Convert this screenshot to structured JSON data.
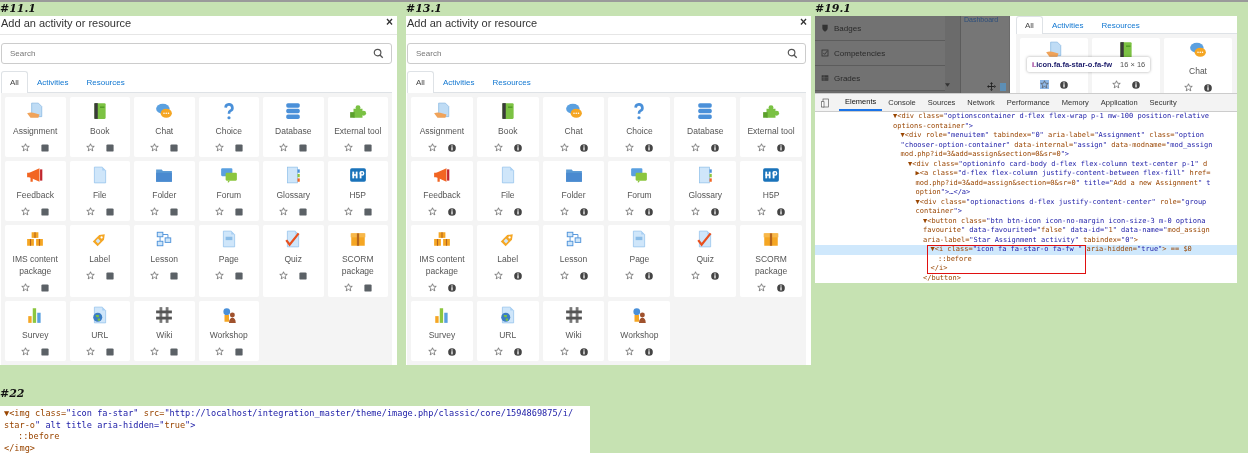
{
  "panels": [
    {
      "label": "#11.1",
      "title": "Add an activity or resource",
      "close": "×",
      "search": {
        "placeholder": "Search"
      },
      "tabs": [
        {
          "label": "All",
          "selected": true
        },
        {
          "label": "Activities",
          "selected": false
        },
        {
          "label": "Resources",
          "selected": false
        }
      ],
      "kind": "square",
      "cards": [
        {
          "kind": "assign",
          "label": "Assignment"
        },
        {
          "kind": "book",
          "label": "Book"
        },
        {
          "kind": "chat",
          "label": "Chat"
        },
        {
          "kind": "choice",
          "label": "Choice"
        },
        {
          "kind": "data",
          "label": "Database"
        },
        {
          "kind": "lti",
          "label": "External tool"
        },
        {
          "kind": "feedback",
          "label": "Feedback"
        },
        {
          "kind": "resource",
          "label": "File"
        },
        {
          "kind": "folder",
          "label": "Folder"
        },
        {
          "kind": "forum",
          "label": "Forum"
        },
        {
          "kind": "glossary",
          "label": "Glossary"
        },
        {
          "kind": "h5p",
          "label": "H5P"
        },
        {
          "kind": "imscp",
          "label": "IMS content package"
        },
        {
          "kind": "label",
          "label": "Label"
        },
        {
          "kind": "lesson",
          "label": "Lesson"
        },
        {
          "kind": "page",
          "label": "Page"
        },
        {
          "kind": "quiz",
          "label": "Quiz"
        },
        {
          "kind": "scorm",
          "label": "SCORM package"
        },
        {
          "kind": "survey",
          "label": "Survey"
        },
        {
          "kind": "url",
          "label": "URL"
        },
        {
          "kind": "wiki",
          "label": "Wiki"
        },
        {
          "kind": "workshop",
          "label": "Workshop"
        }
      ]
    },
    {
      "label": "#13.1",
      "title": "Add an activity or resource",
      "close": "×",
      "search": {
        "placeholder": "Search"
      },
      "tabs": [
        {
          "label": "All",
          "selected": true
        },
        {
          "label": "Activities",
          "selected": false
        },
        {
          "label": "Resources",
          "selected": false
        }
      ],
      "kind": "info",
      "cards": [
        {
          "kind": "assign",
          "label": "Assignment"
        },
        {
          "kind": "book",
          "label": "Book"
        },
        {
          "kind": "chat",
          "label": "Chat"
        },
        {
          "kind": "choice",
          "label": "Choice"
        },
        {
          "kind": "data",
          "label": "Database"
        },
        {
          "kind": "lti",
          "label": "External tool"
        },
        {
          "kind": "feedback",
          "label": "Feedback"
        },
        {
          "kind": "resource",
          "label": "File"
        },
        {
          "kind": "folder",
          "label": "Folder"
        },
        {
          "kind": "forum",
          "label": "Forum"
        },
        {
          "kind": "glossary",
          "label": "Glossary"
        },
        {
          "kind": "h5p",
          "label": "H5P"
        },
        {
          "kind": "imscp",
          "label": "IMS content package"
        },
        {
          "kind": "label",
          "label": "Label"
        },
        {
          "kind": "lesson",
          "label": "Lesson"
        },
        {
          "kind": "page",
          "label": "Page"
        },
        {
          "kind": "quiz",
          "label": "Quiz"
        },
        {
          "kind": "scorm",
          "label": "SCORM package"
        },
        {
          "kind": "survey",
          "label": "Survey"
        },
        {
          "kind": "url",
          "label": "URL"
        },
        {
          "kind": "wiki",
          "label": "Wiki"
        },
        {
          "kind": "workshop",
          "label": "Workshop"
        }
      ]
    }
  ],
  "inspector": {
    "label": "#19.1",
    "sidebar": [
      {
        "kind": "shield",
        "label": "Badges"
      },
      {
        "kind": "checkbox",
        "label": "Competencies"
      },
      {
        "kind": "table",
        "label": "Grades"
      }
    ],
    "breadcrumb": "Dashboard",
    "tabs": [
      {
        "label": "All",
        "selected": true
      },
      {
        "label": "Activities",
        "selected": false
      },
      {
        "label": "Resources",
        "selected": false
      }
    ],
    "cards": [
      {
        "kind": "assign",
        "inspected": true
      },
      {
        "kind": "book",
        "inspected": false
      },
      {
        "kind": "chat",
        "label": "Chat",
        "inspected": false
      }
    ],
    "tooltip": {
      "selector": "i.icon.fa.fa-star-o.fa-fw",
      "size": "16 × 16"
    },
    "devtools_tabs": [
      {
        "label": "Elements",
        "selected": true
      },
      {
        "label": "Console",
        "selected": false
      },
      {
        "label": "Sources",
        "selected": false
      },
      {
        "label": "Network",
        "selected": false
      },
      {
        "label": "Performance",
        "selected": false
      },
      {
        "label": "Memory",
        "selected": false
      },
      {
        "label": "Application",
        "selected": false
      },
      {
        "label": "Security",
        "selected": false
      }
    ],
    "dom": [
      {
        "lines": [
          "▼<div class=\"optionscontainer d-flex flex-wrap p-1 mw-100 position-relative",
          "options-container\">"
        ],
        "children": [
          {
            "lines": [
              "▼<div role=\"menuitem\" tabindex=\"0\" aria-label=\"Assignment\" class=\"option",
              "\"chooser-option-container\" data-internal=\"assign\" data-modname=\"mod_assign",
              "mod.php?id=3&add=assign&section=0&sr=0\">"
            ],
            "children": [
              {
                "lines": [
                  "▼<div class=\"optioninfo card-body d-flex flex-column text-center p-1\" d"
                ],
                "children": [
                  {
                    "lines": [
                      "▶<a class=\"d-flex flex-column justify-content-between flex-fill\" href=",
                      "mod.php?id=3&add=assign&section=0&sr=0\" title=\"Add a new Assignment\" t",
                      "option\">…</a>"
                    ]
                  },
                  {
                    "lines": [
                      "▼<div class=\"optionactions d-flex justify-content-center\" role=\"group",
                      "container\">"
                    ],
                    "children": [
                      {
                        "lines": [
                          "▼<button class=\"btn btn-icon icon-no-margin icon-size-3 m-0 optiona",
                          "favourite\" data-favourited=\"false\" data-id=\"1\" data-name=\"mod_assign",
                          "aria-label=\"Star Assignment activity\" tabindex=\"0\">"
                        ],
                        "children": [
                          {
                            "lines": [
                              "▼<i class=\"icon fa fa-star-o fa-fw \" aria-hidden=\"true\"> == $0"
                            ],
                            "selected": true,
                            "outlined": true,
                            "children": [
                              {
                                "lines": [
                                  "::before"
                                ]
                              }
                            ],
                            "close": "</i>"
                          }
                        ],
                        "close": "</button>"
                      }
                    ]
                  }
                ]
              }
            ]
          }
        ]
      }
    ]
  },
  "snippet": {
    "label": "#22",
    "dom": [
      {
        "lines": [
          "▼<img class=\"icon fa-star\" src=\"http://localhost/integration_master/theme/image.php/classic/core/1594869875/i/",
          "star-o\" alt title aria-hidden=\"true\">"
        ],
        "children": [
          {
            "lines": [
              "::before"
            ]
          }
        ],
        "close": "</img>"
      }
    ]
  }
}
